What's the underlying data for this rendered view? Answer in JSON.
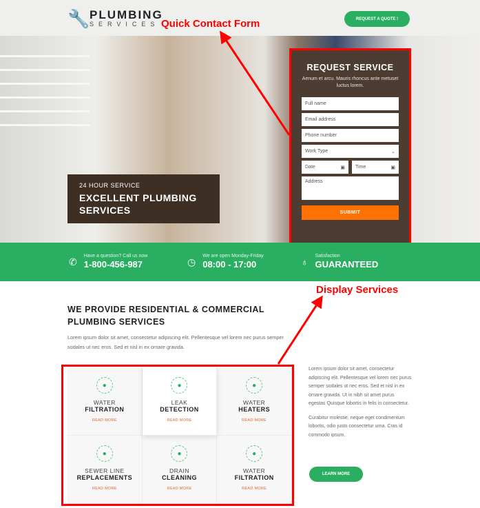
{
  "header": {
    "logo_line1": "PLUMBING",
    "logo_line2": "SERVICES",
    "quote_button": "REQUEST A QUOTE !"
  },
  "hero": {
    "caption_small": "24 HOUR SERVICE",
    "caption_title": "EXCELLENT PLUMBING SERVICES"
  },
  "form": {
    "title": "REQUEST SERVICE",
    "subtitle": "Aenum et arcu. Mauris rhoncus ante metuset luctus lorem.",
    "full_name": "Full name",
    "email": "Email address",
    "phone": "Phone number",
    "work_type": "Work Type",
    "date": "Date",
    "time": "Time",
    "address": "Address",
    "submit": "SUBMIT"
  },
  "band": [
    {
      "icon": "phone-icon",
      "small": "Have a question? Call us now",
      "big": "1-800-456-987"
    },
    {
      "icon": "clock-icon",
      "small": "We are open Monday-Friday",
      "big": "08:00 - 17:00"
    },
    {
      "icon": "lightbulb-icon",
      "small": "Satisfaction",
      "big": "GUARANTEED"
    }
  ],
  "main": {
    "heading": "WE PROVIDE RESIDENTIAL & COMMERCIAL PLUMBING SERVICES",
    "intro": "Lorem ipsum dolor sit amet, consectetur adipiscing elit. Pellentesque vel lorem nec purus semper sodales ut nec eros. Sed et nisl in ex ornare gravida.",
    "services": [
      {
        "l1": "WATER",
        "l2": "FILTRATION",
        "link": "READ MORE"
      },
      {
        "l1": "LEAK",
        "l2": "DETECTION",
        "link": "READ MORE"
      },
      {
        "l1": "WATER",
        "l2": "HEATERS",
        "link": "READ MORE"
      },
      {
        "l1": "SEWER LINE",
        "l2": "REPLACEMENTS",
        "link": "READ MORE"
      },
      {
        "l1": "DRAIN",
        "l2": "CLEANING",
        "link": "READ MORE"
      },
      {
        "l1": "WATER",
        "l2": "FILTRATION",
        "link": "READ MORE"
      }
    ],
    "side_p1": "Lorem ipsum dolor sit amet, consectetur adipiscing elit. Pellentesque vel lorem nec purus semper sodales ut nec eros. Sed et nisl in ex ornare gravida. Ut in nibh sit amet purus egestas Quisque lobortis in felis in consectetur.",
    "side_p2": "Curabitur molestie, neque eget condimentum lobortis, odio justo consectetur urna. Cras id commodo ipsum.",
    "learn_more": "LEARN MORE"
  },
  "annotations": {
    "form_label": "Quick Contact Form",
    "services_label": "Display Services"
  },
  "colors": {
    "green": "#2aae62",
    "orange": "#ff7102",
    "annotation": "#ff0000"
  }
}
